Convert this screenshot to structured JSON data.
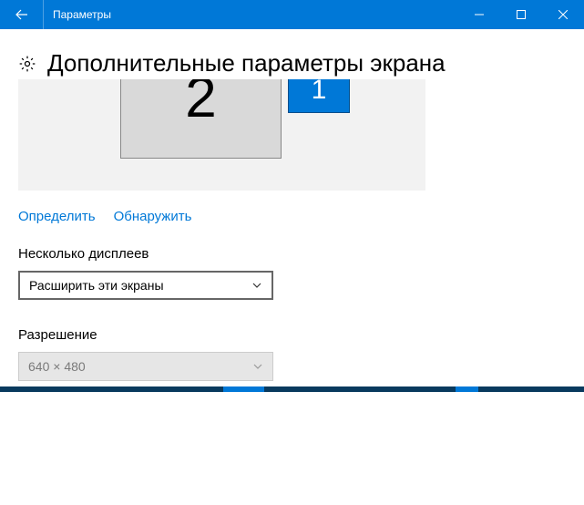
{
  "titlebar": {
    "title": "Параметры"
  },
  "page": {
    "heading": "Дополнительные параметры экрана"
  },
  "monitors": {
    "primary_label": "2",
    "secondary_label": "1"
  },
  "links": {
    "identify": "Определить",
    "detect": "Обнаружить"
  },
  "multiple_displays": {
    "label": "Несколько дисплеев",
    "value": "Расширить эти экраны"
  },
  "resolution": {
    "label": "Разрешение",
    "value": "640 × 480"
  }
}
